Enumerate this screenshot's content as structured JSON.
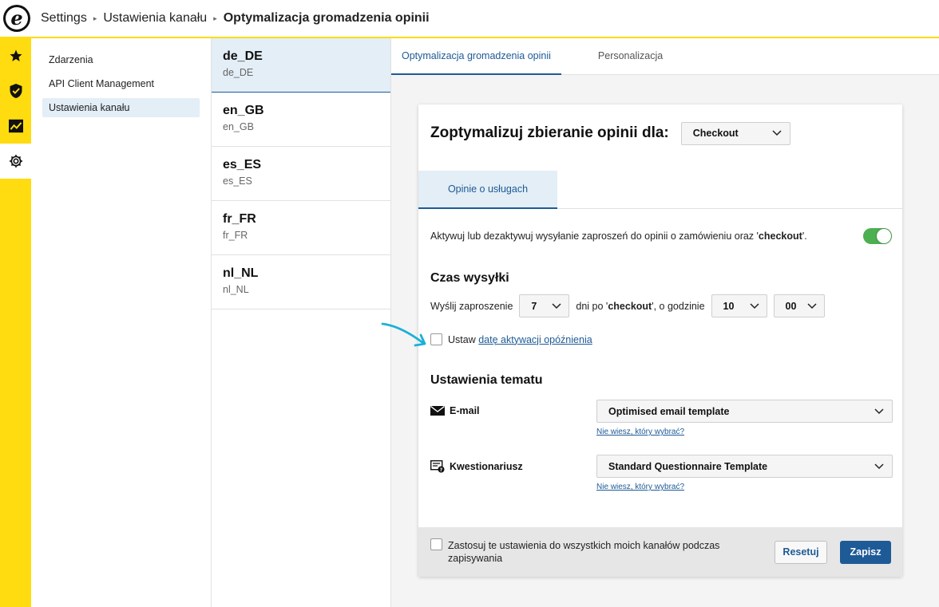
{
  "breadcrumb": {
    "items": [
      "Settings",
      "Ustawienia kanału"
    ],
    "current": "Optymalizacja gromadzenia opinii",
    "separator": "▸"
  },
  "rail": {
    "icons": [
      "star-icon",
      "shield-check-icon",
      "chart-icon",
      "gear-icon"
    ],
    "active": "gear-icon"
  },
  "submenu": {
    "items": [
      {
        "label": "Zdarzenia"
      },
      {
        "label": "API Client Management"
      },
      {
        "label": "Ustawienia kanału"
      }
    ],
    "active_index": 2
  },
  "locales": [
    {
      "code": "de_DE",
      "sub": "de_DE"
    },
    {
      "code": "en_GB",
      "sub": "en_GB"
    },
    {
      "code": "es_ES",
      "sub": "es_ES"
    },
    {
      "code": "fr_FR",
      "sub": "fr_FR"
    },
    {
      "code": "nl_NL",
      "sub": "nl_NL"
    }
  ],
  "tabs": {
    "optimization": "Optymalizacja gromadzenia opinii",
    "personalization": "Personalizacja"
  },
  "card": {
    "title": "Zoptymalizuj zbieranie opinii dla:",
    "event_select": "Checkout",
    "inner_tab": "Opinie o usługach",
    "activate_text_prefix": "Aktywuj lub dezaktywuj wysyłanie zaproszeń do opinii o zamówieniu oraz '",
    "activate_text_bold": "checkout",
    "activate_text_suffix": "'.",
    "toggle_on": true,
    "send_time": {
      "heading": "Czas wysyłki",
      "prefix": "Wyślij zaproszenie",
      "days": "7",
      "middle_prefix": "dni po '",
      "middle_bold": "checkout",
      "middle_suffix": "', o godzinie",
      "hour": "10",
      "minute": "00"
    },
    "delay": {
      "label": "Ustaw",
      "link": "datę aktywacji opóźnienia"
    },
    "theme": {
      "heading": "Ustawienia tematu",
      "email_label": "E-mail",
      "email_template": "Optimised email template",
      "questionnaire_label": "Kwestionariusz",
      "questionnaire_template": "Standard Questionnaire Template",
      "help_link": "Nie wiesz, który wybrać?"
    },
    "footer": {
      "apply_all": "Zastosuj te ustawienia do wszystkich moich kanałów podczas zapisywania",
      "reset": "Resetuj",
      "save": "Zapisz"
    }
  },
  "colors": {
    "brand_yellow": "#ffdc0f",
    "accent_blue": "#1e5a96",
    "toggle_green": "#4caf50",
    "annotation_arrow": "#1ab0d8"
  }
}
